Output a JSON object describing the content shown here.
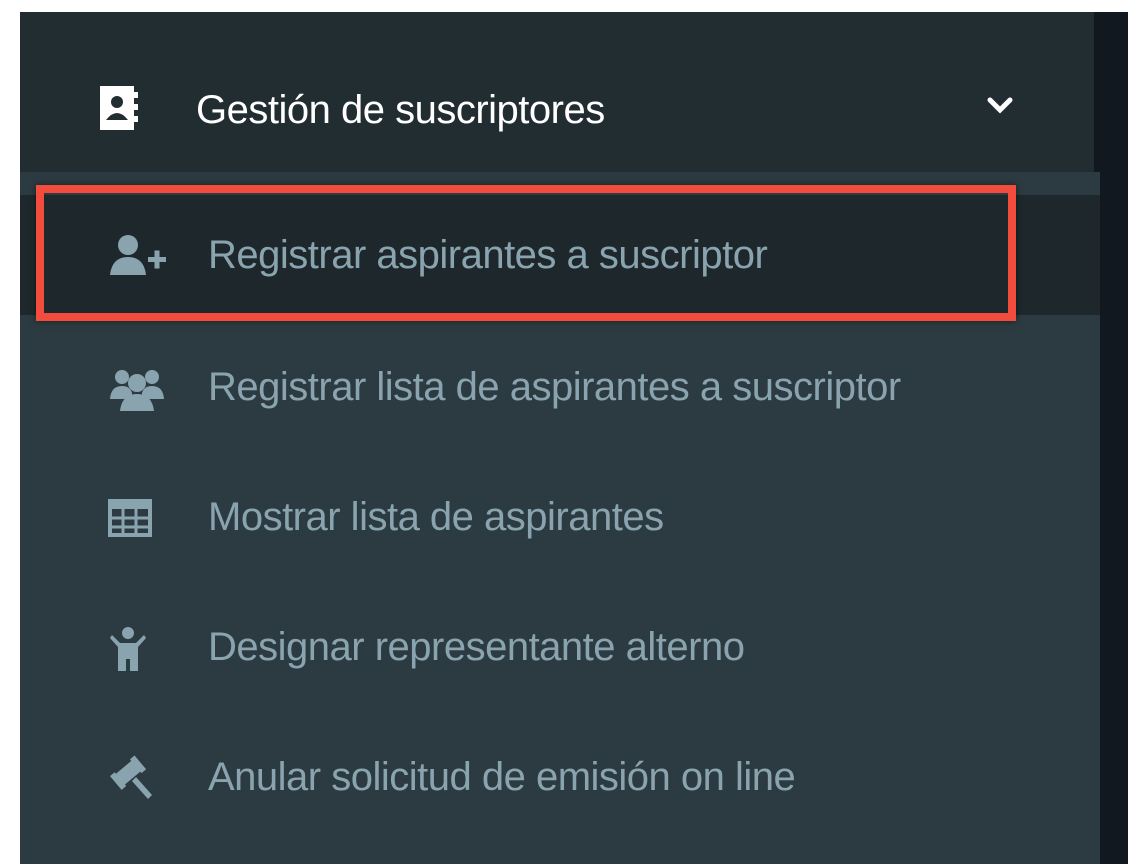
{
  "menu": {
    "header": {
      "label": "Gestión de suscriptores",
      "icon": "address-book-icon",
      "chevron": "chevron-down-icon"
    },
    "items": [
      {
        "label": "Registrar aspirantes a suscriptor",
        "icon": "user-plus-icon",
        "active": true
      },
      {
        "label": "Registrar lista de aspirantes a suscriptor",
        "icon": "users-icon"
      },
      {
        "label": "Mostrar lista de aspirantes",
        "icon": "table-icon"
      },
      {
        "label": "Designar representante alterno",
        "icon": "child-icon"
      },
      {
        "label": "Anular solicitud de emisión on line",
        "icon": "gavel-icon"
      }
    ]
  },
  "colors": {
    "sidebar_bg": "#222d32",
    "submenu_bg": "#2c3b41",
    "item_text": "#8aa4af",
    "highlight": "#f24c3d"
  }
}
